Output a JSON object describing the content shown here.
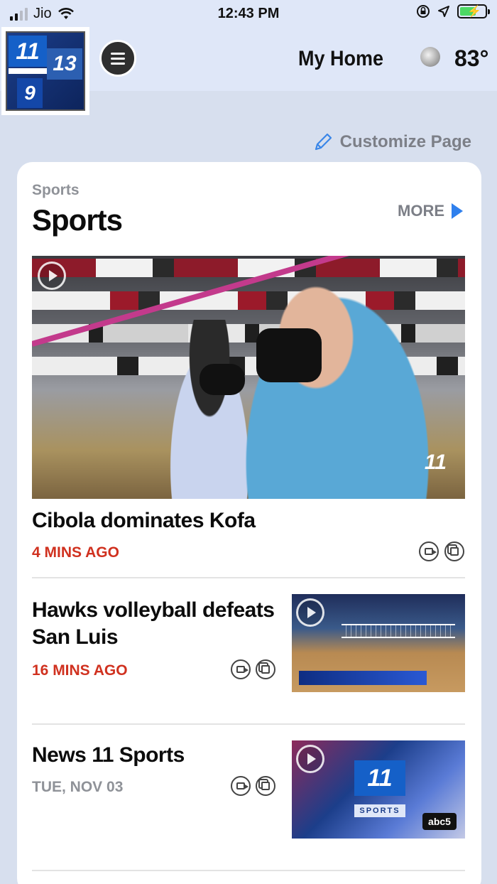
{
  "status_bar": {
    "carrier": "Jio",
    "time": "12:43 PM"
  },
  "header": {
    "logo_alt": "11 / 13 / 9 FOX",
    "title": "My Home",
    "temperature": "83°"
  },
  "customize": {
    "label": "Customize Page"
  },
  "section": {
    "kicker": "Sports",
    "title": "Sports",
    "more_label": "MORE",
    "accent_color": "#2f80ed"
  },
  "stories": [
    {
      "title": "Cibola dominates Kofa",
      "time": "4 MINS AGO",
      "time_color": "#d0311f"
    },
    {
      "title": "Hawks volleyball defeats San Luis",
      "time": "16 MINS AGO",
      "time_color": "#d0311f"
    },
    {
      "title": "News 11 Sports",
      "time": "TUE, NOV 03",
      "time_color": "#8f9298"
    }
  ],
  "icons": [
    "signal-icon",
    "wifi-icon",
    "lock-rotation-icon",
    "location-icon",
    "battery-icon",
    "menu-icon",
    "moon-icon",
    "pencil-icon",
    "play-icon",
    "video-icon",
    "gallery-icon"
  ]
}
